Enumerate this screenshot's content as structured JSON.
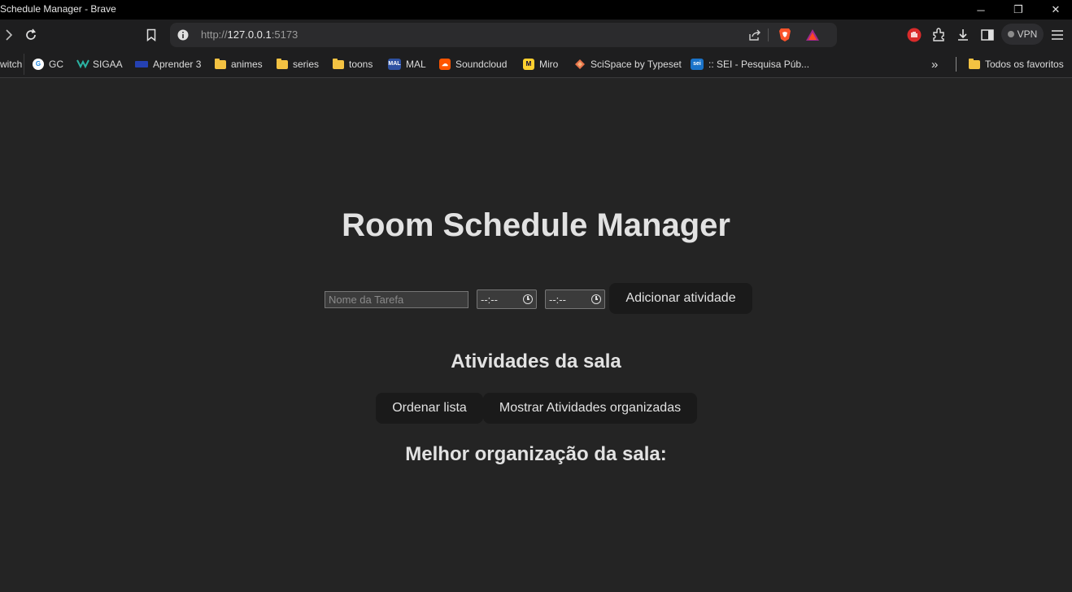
{
  "window": {
    "title": "Schedule Manager - Brave",
    "minimize": "─",
    "restore": "❐",
    "close": "✕"
  },
  "toolbar": {
    "url_scheme": "http://",
    "url_host": "127.0.0.1",
    "url_port": ":5173",
    "vpn_label": "VPN",
    "icons": [
      "forward-icon",
      "reload-icon",
      "bookmark-icon",
      "site-info-icon",
      "share-icon",
      "brave-shield-icon",
      "brave-rewards-icon",
      "stop-icon",
      "extensions-icon",
      "download-icon",
      "sidebar-icon",
      "menu-icon"
    ]
  },
  "bookmarks": {
    "items": [
      {
        "label": "witch"
      },
      {
        "label": "GC"
      },
      {
        "label": "SIGAA"
      },
      {
        "label": "Aprender 3"
      },
      {
        "label": "animes"
      },
      {
        "label": "series"
      },
      {
        "label": "toons"
      },
      {
        "label": "MAL"
      },
      {
        "label": "Soundcloud"
      },
      {
        "label": "Miro"
      },
      {
        "label": "SciSpace by Typeset"
      },
      {
        "label": ":: SEI - Pesquisa Púb..."
      }
    ],
    "more": "»",
    "all_favorites": "Todos os favoritos"
  },
  "page": {
    "title": "Room Schedule Manager",
    "task_placeholder": "Nome da Tarefa",
    "start_time_display": "--:--",
    "end_time_display": "--:--",
    "add_button": "Adicionar atividade",
    "activities_heading": "Atividades da sala",
    "sort_button": "Ordenar lista",
    "show_button": "Mostrar Atividades organizadas",
    "best_org_heading": "Melhor organização da sala:"
  }
}
